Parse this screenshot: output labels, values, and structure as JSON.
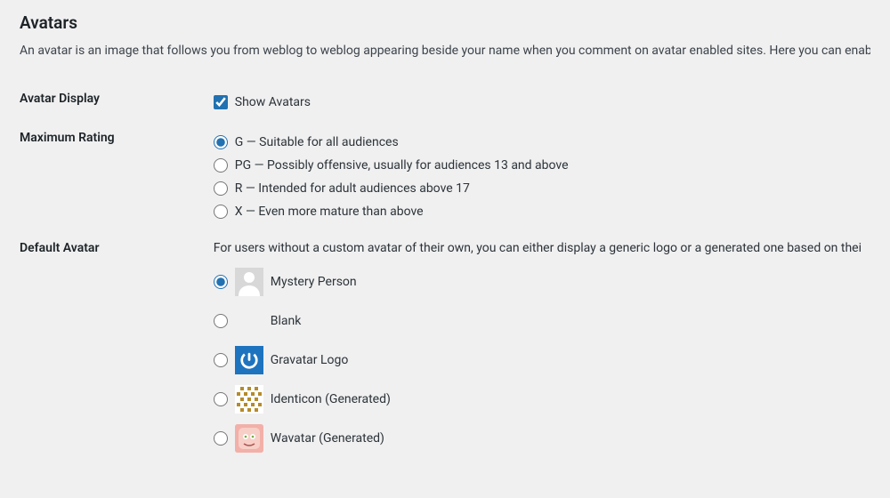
{
  "heading": "Avatars",
  "intro": "An avatar is an image that follows you from weblog to weblog appearing beside your name when you comment on avatar enabled sites. Here you can enable the di",
  "avatar_display": {
    "label": "Avatar Display",
    "checkbox_label": "Show Avatars",
    "checked": true
  },
  "max_rating": {
    "label": "Maximum Rating",
    "selected": "G",
    "options": [
      {
        "value": "G",
        "text": "G — Suitable for all audiences"
      },
      {
        "value": "PG",
        "text": "PG — Possibly offensive, usually for audiences 13 and above"
      },
      {
        "value": "R",
        "text": "R — Intended for adult audiences above 17"
      },
      {
        "value": "X",
        "text": "X — Even more mature than above"
      }
    ]
  },
  "default_avatar": {
    "label": "Default Avatar",
    "intro": "For users without a custom avatar of their own, you can either display a generic logo or a generated one based on thei",
    "selected": "mystery",
    "options": [
      {
        "value": "mystery",
        "text": "Mystery Person"
      },
      {
        "value": "blank",
        "text": "Blank"
      },
      {
        "value": "gravatar",
        "text": "Gravatar Logo"
      },
      {
        "value": "identicon",
        "text": "Identicon (Generated)"
      },
      {
        "value": "wavatar",
        "text": "Wavatar (Generated)"
      }
    ]
  }
}
